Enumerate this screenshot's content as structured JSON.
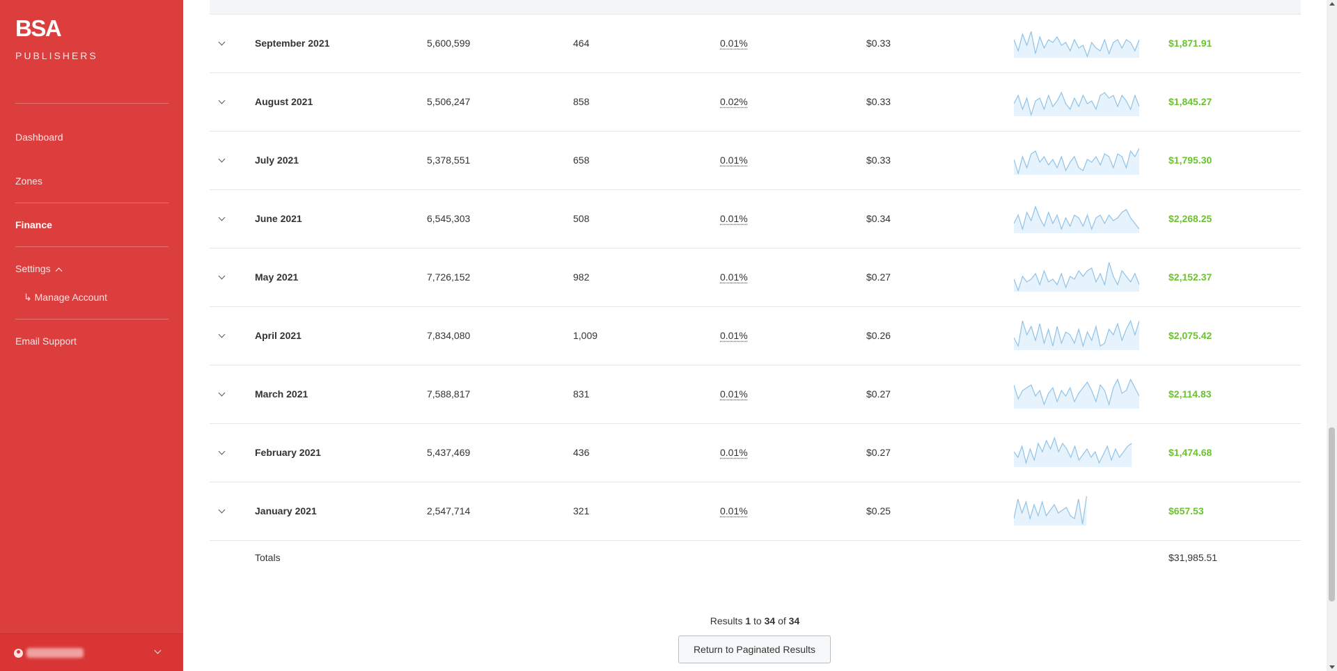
{
  "sidebar": {
    "logo": "BSA",
    "subtitle": "PUBLISHERS",
    "nav": {
      "dashboard": "Dashboard",
      "zones": "Zones",
      "finance": "Finance",
      "settings": "Settings",
      "manage_account": "↳ Manage Account",
      "email_support": "Email Support"
    }
  },
  "table": {
    "rows": [
      {
        "month": "September 2021",
        "impressions": "5,600,599",
        "clicks": "464",
        "ctr": "0.01%",
        "cpc": "$0.33",
        "earnings": "$1,871.91",
        "spark": [
          6,
          2,
          8,
          4,
          9,
          1,
          7,
          3,
          6,
          5,
          7,
          4,
          5,
          2,
          6,
          3,
          4,
          0,
          5,
          3,
          2,
          6,
          1,
          5,
          6,
          3,
          6,
          5,
          2,
          6
        ],
        "spark_span": 1.0
      },
      {
        "month": "August 2021",
        "impressions": "5,506,247",
        "clicks": "858",
        "ctr": "0.02%",
        "cpc": "$0.33",
        "earnings": "$1,845.27",
        "spark": [
          4,
          7,
          2,
          6,
          0,
          5,
          6,
          2,
          7,
          3,
          5,
          8,
          4,
          2,
          6,
          3,
          7,
          4,
          5,
          2,
          7,
          8,
          6,
          7,
          3,
          7,
          5,
          2,
          7,
          3
        ],
        "spark_span": 1.0
      },
      {
        "month": "July 2021",
        "impressions": "5,378,551",
        "clicks": "658",
        "ctr": "0.01%",
        "cpc": "$0.33",
        "earnings": "$1,795.30",
        "spark": [
          5,
          0,
          6,
          2,
          7,
          8,
          4,
          6,
          3,
          5,
          2,
          6,
          1,
          4,
          6,
          2,
          1,
          5,
          4,
          6,
          3,
          7,
          6,
          2,
          7,
          6,
          2,
          8,
          6,
          9
        ],
        "spark_span": 1.0
      },
      {
        "month": "June 2021",
        "impressions": "6,545,303",
        "clicks": "508",
        "ctr": "0.01%",
        "cpc": "$0.34",
        "earnings": "$2,268.25",
        "spark": [
          3,
          6,
          1,
          7,
          4,
          9,
          5,
          2,
          7,
          3,
          6,
          1,
          5,
          2,
          6,
          5,
          2,
          6,
          1,
          5,
          6,
          3,
          6,
          4,
          5,
          7,
          8,
          5,
          3,
          1
        ],
        "spark_span": 1.0
      },
      {
        "month": "May 2021",
        "impressions": "7,726,152",
        "clicks": "982",
        "ctr": "0.01%",
        "cpc": "$0.27",
        "earnings": "$2,152.37",
        "spark": [
          4,
          0,
          5,
          3,
          4,
          6,
          2,
          7,
          3,
          4,
          2,
          6,
          1,
          5,
          4,
          7,
          5,
          7,
          8,
          3,
          6,
          2,
          10,
          5,
          2,
          7,
          5,
          3,
          6,
          2
        ],
        "spark_span": 1.0
      },
      {
        "month": "April 2021",
        "impressions": "7,834,080",
        "clicks": "1,009",
        "ctr": "0.01%",
        "cpc": "$0.26",
        "earnings": "$2,075.42",
        "spark": [
          4,
          1,
          10,
          5,
          8,
          3,
          9,
          2,
          7,
          1,
          8,
          2,
          6,
          5,
          2,
          7,
          1,
          6,
          3,
          8,
          1,
          2,
          7,
          5,
          9,
          3,
          7,
          10,
          5,
          10
        ],
        "spark_span": 1.0
      },
      {
        "month": "March 2021",
        "impressions": "7,588,817",
        "clicks": "831",
        "ctr": "0.01%",
        "cpc": "$0.27",
        "earnings": "$2,114.83",
        "spark": [
          8,
          3,
          6,
          7,
          8,
          4,
          6,
          1,
          5,
          7,
          2,
          6,
          4,
          7,
          2,
          5,
          7,
          9,
          6,
          2,
          8,
          6,
          1,
          7,
          10,
          5,
          6,
          10,
          7,
          4
        ],
        "spark_span": 1.0
      },
      {
        "month": "February 2021",
        "impressions": "5,437,469",
        "clicks": "436",
        "ctr": "0.01%",
        "cpc": "$0.27",
        "earnings": "$1,474.68",
        "spark": [
          5,
          3,
          7,
          1,
          6,
          2,
          8,
          5,
          9,
          6,
          10,
          5,
          8,
          6,
          3,
          7,
          2,
          4,
          6,
          3,
          5,
          1,
          4,
          7,
          2,
          6,
          3,
          5,
          7,
          8
        ],
        "spark_span": 0.94
      },
      {
        "month": "January 2021",
        "impressions": "2,547,714",
        "clicks": "321",
        "ctr": "0.01%",
        "cpc": "$0.25",
        "earnings": "$657.53",
        "spark": [
          2,
          9,
          4,
          8,
          2,
          7,
          3,
          8,
          3,
          5,
          7,
          4,
          5,
          6,
          3,
          2,
          9,
          0,
          10
        ],
        "spark_span": 0.58
      }
    ],
    "totals_label": "Totals",
    "totals_value": "$31,985.51"
  },
  "results": {
    "prefix": "Results",
    "start": "1",
    "to": "to",
    "end": "34",
    "of": "of",
    "total": "34"
  },
  "return_button": "Return to Paginated Results",
  "colors": {
    "sidebar": "#dc3e3d",
    "earnings": "#6cc130",
    "spark_stroke": "#8fc3e8",
    "spark_fill": "#e6f2fc"
  }
}
